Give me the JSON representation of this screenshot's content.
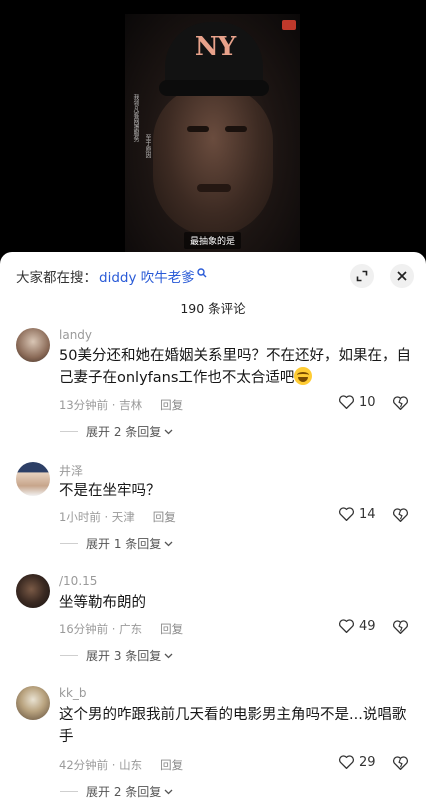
{
  "video": {
    "cap_logo": "NY",
    "subtitle": "最抽象的是",
    "vertical_text_1": "我领凡客网罩服务",
    "vertical_text_2": "至于原因"
  },
  "panel": {
    "search_prefix": "大家都在搜：",
    "search_term": "diddy 吹牛老爹",
    "count_text": "190 条评论",
    "reply_label": "回复"
  },
  "comments": [
    {
      "username": "landy",
      "text": "50美分还和她在婚姻关系里吗？不在还好，如果在，自己妻子在onlyfans工作也不太合适吧",
      "time_loc": "13分钟前 · 吉林",
      "likes": "10",
      "expand": "展开 2 条回复"
    },
    {
      "username": "井泽",
      "text": "不是在坐牢吗？",
      "time_loc": "1小时前 · 天津",
      "likes": "14",
      "expand": "展开 1 条回复"
    },
    {
      "username": "/10.15",
      "text": "坐等勒布朗的",
      "time_loc": "16分钟前 · 广东",
      "likes": "49",
      "expand": "展开 3 条回复"
    },
    {
      "username": "kk_b",
      "text": "这个男的咋跟我前几天看的电影男主角吗不是...说唱歌手",
      "time_loc": "42分钟前 · 山东",
      "likes": "29",
      "expand": "展开 2 条回复"
    }
  ],
  "colors": {
    "link_blue": "#2a5bd7",
    "meta_gray": "#9a9a9a"
  }
}
